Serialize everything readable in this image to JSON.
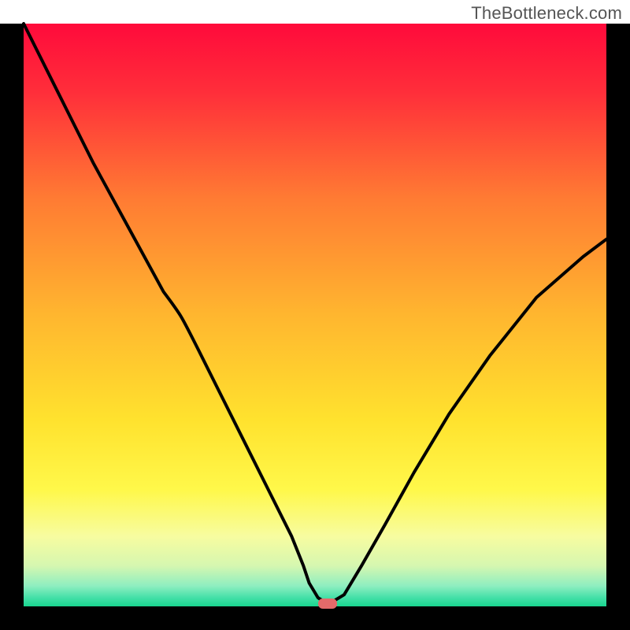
{
  "watermark": "TheBottleneck.com",
  "chart_data": {
    "type": "line",
    "title": "",
    "xlabel": "",
    "ylabel": "",
    "xlim": [
      0,
      100
    ],
    "ylim": [
      0,
      100
    ],
    "background": {
      "type": "vertical-gradient",
      "stops": [
        {
          "pos": 0.0,
          "color": "#ff0a3b"
        },
        {
          "pos": 0.12,
          "color": "#ff2f3a"
        },
        {
          "pos": 0.3,
          "color": "#ff7b33"
        },
        {
          "pos": 0.5,
          "color": "#ffb62f"
        },
        {
          "pos": 0.68,
          "color": "#ffe22e"
        },
        {
          "pos": 0.8,
          "color": "#fff84a"
        },
        {
          "pos": 0.88,
          "color": "#f7fca0"
        },
        {
          "pos": 0.93,
          "color": "#d6f7b0"
        },
        {
          "pos": 0.965,
          "color": "#8eeec0"
        },
        {
          "pos": 0.985,
          "color": "#44e0a8"
        },
        {
          "pos": 1.0,
          "color": "#18d68f"
        }
      ]
    },
    "series": [
      {
        "name": "bottleneck-curve",
        "x": [
          0,
          6,
          12,
          18,
          24,
          27,
          30,
          34,
          38,
          42,
          46,
          48,
          49,
          50.5,
          52,
          52.5,
          55,
          58,
          62,
          67,
          73,
          80,
          88,
          96,
          100
        ],
        "y": [
          100,
          88,
          76,
          65,
          54,
          50,
          44,
          36,
          28,
          20,
          12,
          7,
          4,
          1.5,
          0.5,
          0.5,
          2,
          7,
          14,
          23,
          33,
          43,
          53,
          60,
          63
        ]
      }
    ],
    "marker": {
      "name": "optimal-point",
      "x": 52,
      "y": 0.5,
      "color": "#e46a6a",
      "shape": "rounded-rect"
    },
    "frame": {
      "left_border": true,
      "right_border": true,
      "bottom_border": true,
      "top_border": false,
      "color": "#000000",
      "thickness_px": 30
    }
  }
}
